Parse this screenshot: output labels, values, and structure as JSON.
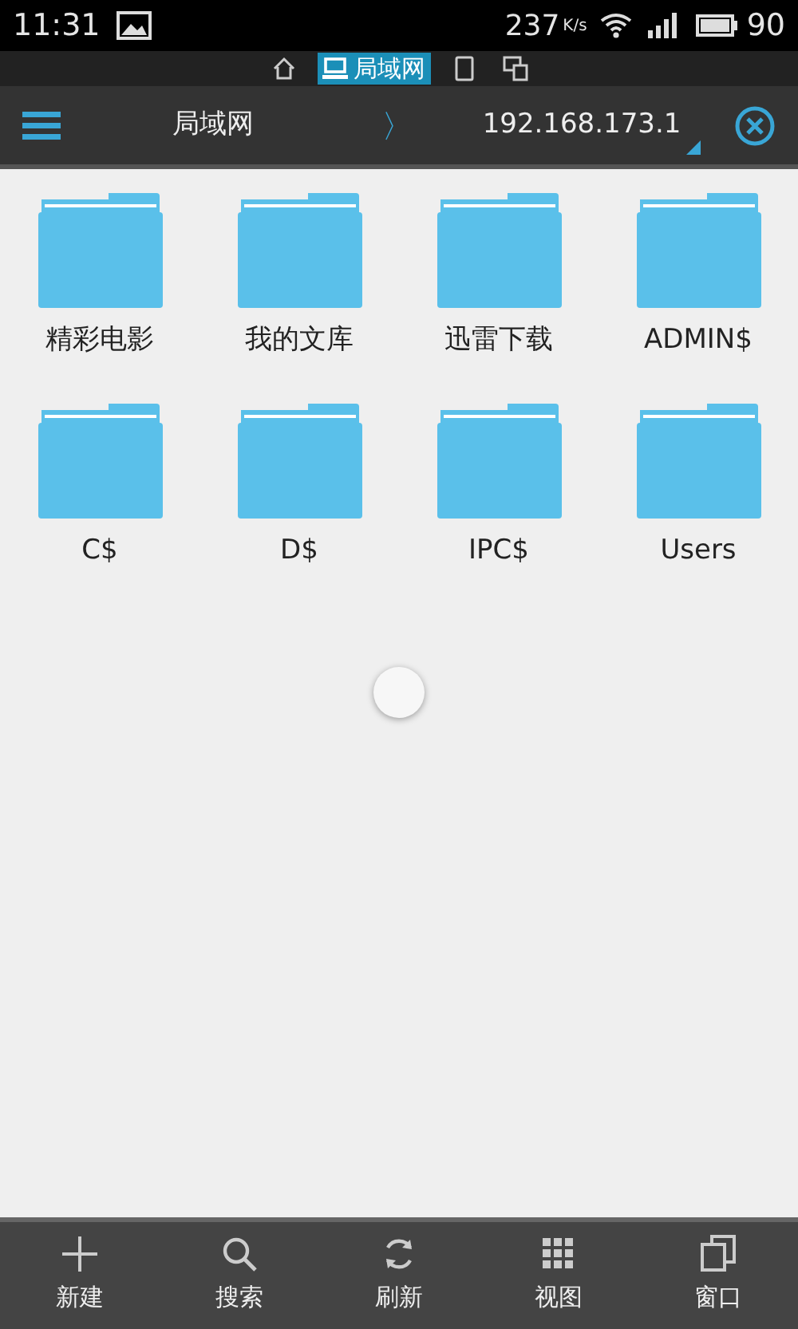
{
  "status_bar": {
    "time": "11:31",
    "speed": "237",
    "speed_unit": "K/s",
    "battery": "90"
  },
  "location_tabs": [
    {
      "kind": "home",
      "selected": false
    },
    {
      "kind": "lan",
      "label": "局域网",
      "selected": true
    },
    {
      "kind": "phone",
      "selected": false
    },
    {
      "kind": "devices",
      "selected": false
    }
  ],
  "path_bar": {
    "crumbs": [
      "局域网",
      "192.168.173.1"
    ],
    "separator": "〉"
  },
  "folders": [
    {
      "name": "精彩电影"
    },
    {
      "name": "我的文库"
    },
    {
      "name": "迅雷下载"
    },
    {
      "name": "ADMIN$"
    },
    {
      "name": "C$"
    },
    {
      "name": "D$"
    },
    {
      "name": "IPC$"
    },
    {
      "name": "Users"
    }
  ],
  "toolbar": [
    {
      "kind": "new",
      "label": "新建"
    },
    {
      "kind": "search",
      "label": "搜索"
    },
    {
      "kind": "refresh",
      "label": "刷新"
    },
    {
      "kind": "view",
      "label": "视图"
    },
    {
      "kind": "windows",
      "label": "窗口"
    }
  ]
}
